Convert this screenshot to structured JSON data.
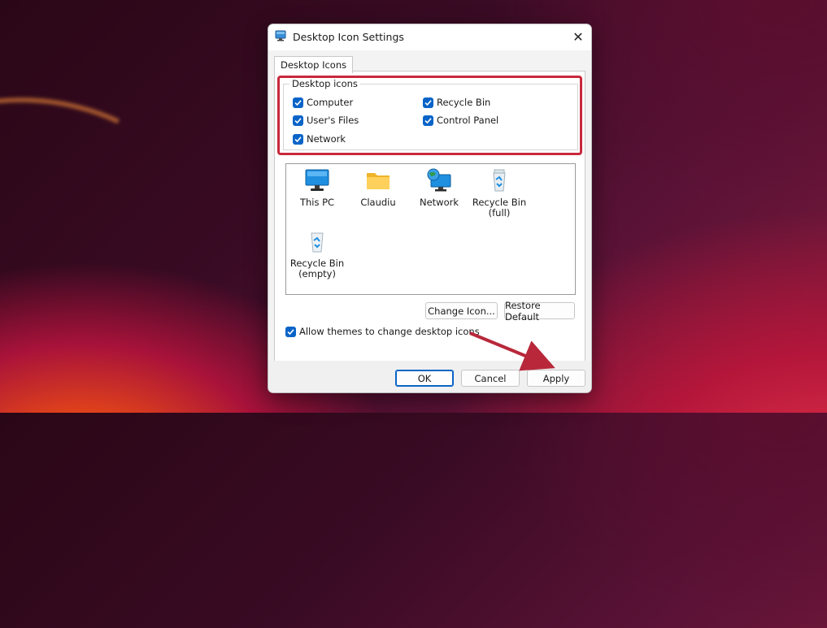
{
  "window": {
    "title": "Desktop Icon Settings",
    "close_glyph": "✕"
  },
  "tabs": [
    {
      "label": "Desktop Icons"
    }
  ],
  "group": {
    "legend": "Desktop icons",
    "checkboxes": [
      {
        "label": "Computer",
        "checked": true
      },
      {
        "label": "Recycle Bin",
        "checked": true
      },
      {
        "label": "User's Files",
        "checked": true
      },
      {
        "label": "Control Panel",
        "checked": true
      },
      {
        "label": "Network",
        "checked": true
      }
    ]
  },
  "icons": [
    {
      "name": "this-pc",
      "line1": "This PC",
      "line2": "",
      "icon": "monitor-icon"
    },
    {
      "name": "claudiu",
      "line1": "Claudiu",
      "line2": "",
      "icon": "folder-icon"
    },
    {
      "name": "network",
      "line1": "Network",
      "line2": "",
      "icon": "network-globe-icon"
    },
    {
      "name": "recycle-bin-full",
      "line1": "Recycle Bin",
      "line2": "(full)",
      "icon": "recycle-bin-full-icon"
    },
    {
      "name": "recycle-bin-empty",
      "line1": "Recycle Bin",
      "line2": "(empty)",
      "icon": "recycle-bin-empty-icon"
    }
  ],
  "buttons": {
    "change_icon": "Change Icon...",
    "restore_default": "Restore Default",
    "ok": "OK",
    "cancel": "Cancel",
    "apply": "Apply"
  },
  "allow_themes": {
    "label": "Allow themes to change desktop icons",
    "checked": true
  },
  "colors": {
    "accent": "#0a64c8",
    "highlight": "#c8283c",
    "arrow": "#b8283a"
  }
}
